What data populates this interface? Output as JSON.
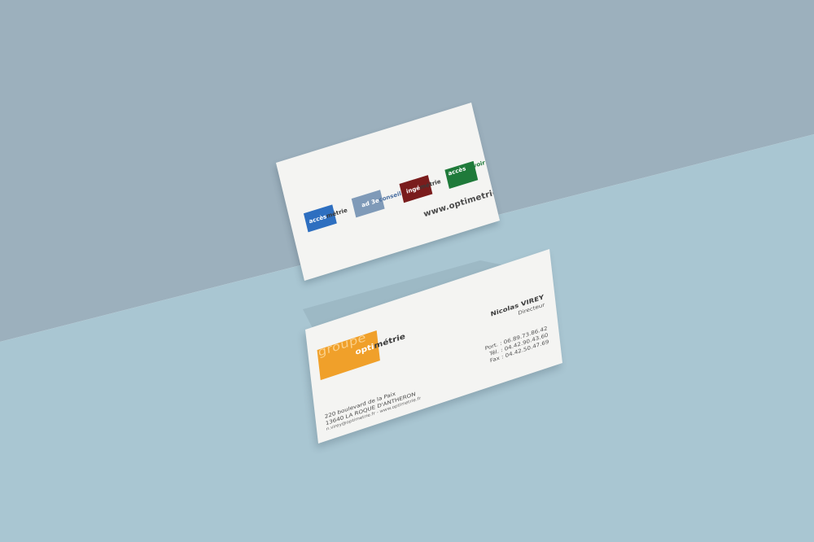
{
  "colors": {
    "wall": "#9cb0bd",
    "floor": "#a9c6d2",
    "card": "#f4f4f2",
    "accesmetrie": "#2e6fc0",
    "ad3conseil": "#7f9ab8",
    "ingemetrie": "#7a1c1c",
    "accessavoir": "#1f7a3a",
    "optimetrie": "#f0a02a"
  },
  "back_card": {
    "logos": [
      {
        "light": "accès",
        "dark": "métrie",
        "icon": "accesmetrie-logo"
      },
      {
        "light": "ad 3e",
        "dark": "conseil",
        "icon": "ad3conseil-logo"
      },
      {
        "light": "ingé",
        "dark": "métrie",
        "icon": "ingemetrie-logo"
      },
      {
        "light": "accès",
        "dark": "savoir",
        "icon": "accessavoir-logo"
      }
    ],
    "website": "www.optimetrie.fr"
  },
  "front_card": {
    "logo": {
      "groupe": "groupe",
      "opti": "opti",
      "metrie": "métrie"
    },
    "name": "Nicolas VIREY",
    "title": "Directeur",
    "port": "Port. : 06.89.73.86.42",
    "tel": "Tél. : 04.42.90.43.60",
    "fax": "Fax : 04.42.50.47.69",
    "address1": "220 boulevard de la Paix",
    "address2": "13640 LA ROQUE D'ANTHERON",
    "contact": "n.virey@optimetrie.fr  -  www.optimetrie.fr"
  }
}
